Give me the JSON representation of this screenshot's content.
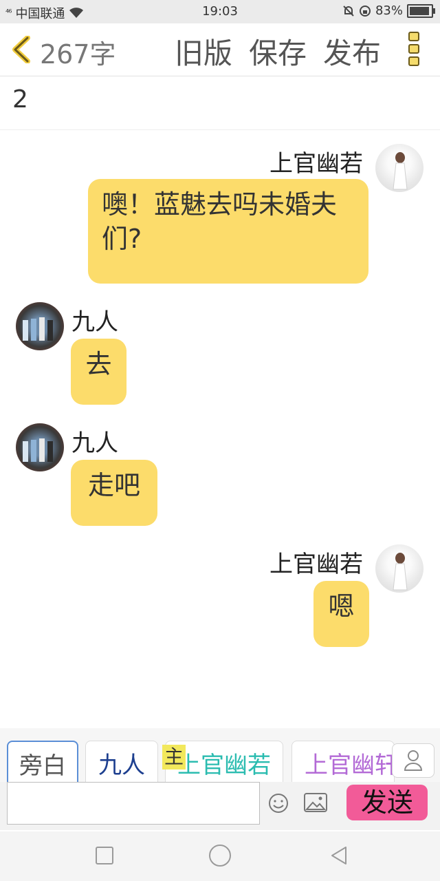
{
  "status_bar": {
    "signal": "⁴⁶",
    "carrier": "中国联通",
    "time": "19:03",
    "battery": "83%"
  },
  "toolbar": {
    "word_count": "267字",
    "old_version": "旧版",
    "save": "保存",
    "publish": "发布"
  },
  "title": "2",
  "messages": [
    {
      "side": "right",
      "name": "上官幽若",
      "text": "噢！蓝魅去吗未婚夫们?"
    },
    {
      "side": "left",
      "name": "九人",
      "text": "去"
    },
    {
      "side": "left",
      "name": "九人",
      "text": "走吧"
    },
    {
      "side": "right",
      "name": "上官幽若",
      "text": "嗯"
    }
  ],
  "roles": {
    "narrator": "旁白",
    "jiuren": "九人",
    "main_badge": "主",
    "shangguan": "上官幽若",
    "shangguan2": "上官幽轩"
  },
  "input": {
    "placeholder": "",
    "send": "发送"
  },
  "colors": {
    "bubble": "#fcdc6b",
    "send_button": "#f25b98",
    "role_jiuren": "#1d3f8f",
    "role_shangguan": "#2bbcb0",
    "role_shangguan2": "#b36ad6"
  }
}
